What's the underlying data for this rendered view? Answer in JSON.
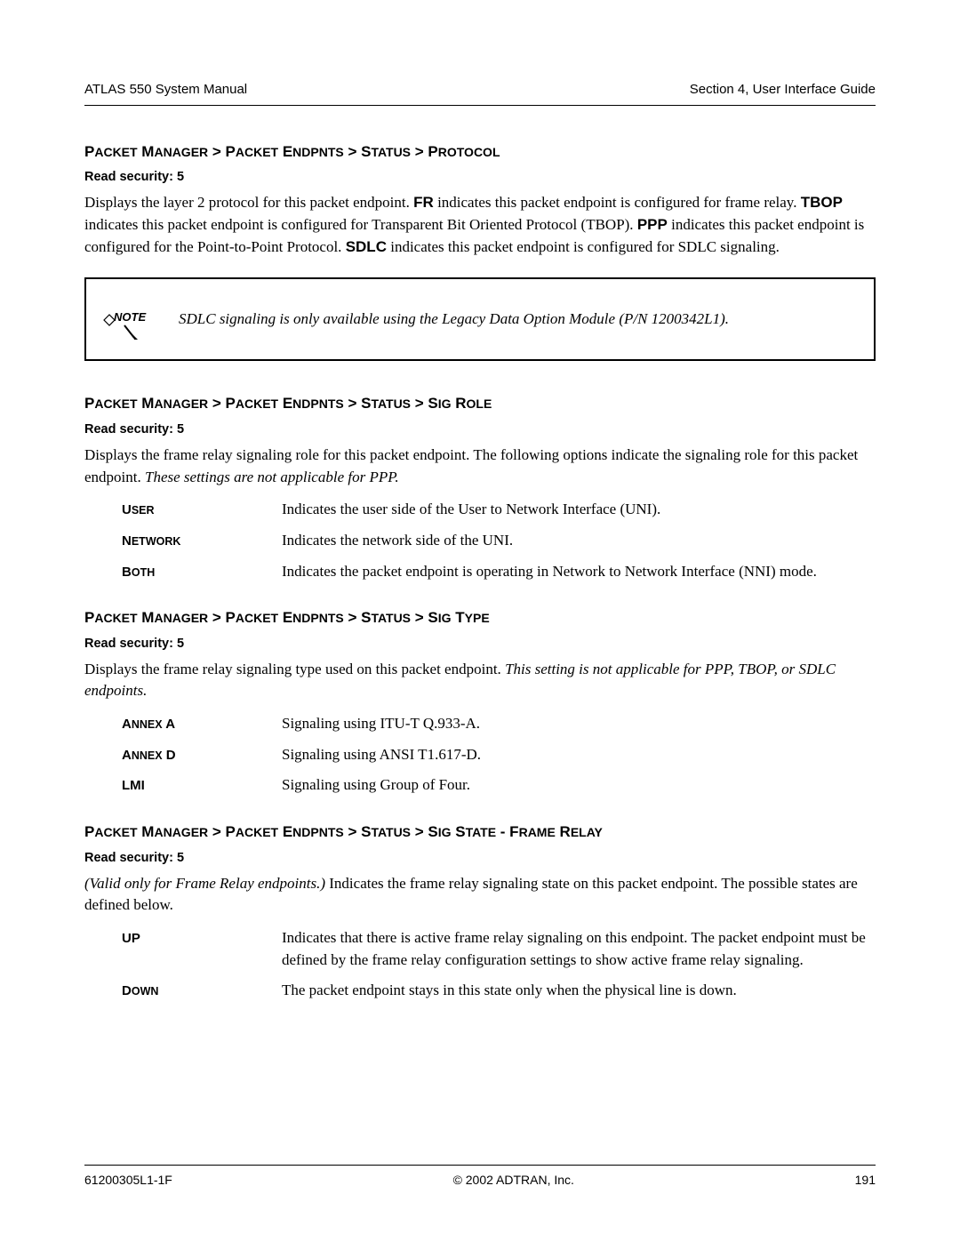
{
  "header": {
    "left": "ATLAS 550 System Manual",
    "right": "Section 4, User Interface Guide"
  },
  "section1": {
    "heading_parts": [
      "P",
      "ACKET",
      " M",
      "ANAGER",
      " > P",
      "ACKET",
      " E",
      "NDPNTS",
      " > S",
      "TATUS",
      " > P",
      "ROTOCOL"
    ],
    "read_sec": "Read security: 5",
    "para_pre_FR": "Displays the layer 2 protocol for this packet endpoint. ",
    "b_FR": "FR",
    "para_post_FR": " indicates this packet endpoint is configured for frame relay. ",
    "b_TBOP": "TBOP",
    "para_post_TBOP": " indicates this packet endpoint is configured for Transparent Bit Oriented Protocol (TBOP). ",
    "b_PPP": "PPP",
    "para_post_PPP": " indicates this packet endpoint is configured for the Point-to-Point Protocol. ",
    "b_SDLC": "SDLC",
    "para_post_SDLC": " indicates this packet endpoint is configured for SDLC signaling.",
    "note_label": "NOTE",
    "note_text": "SDLC signaling is only available using the Legacy Data Option Module (P/N 1200342L1)."
  },
  "section2": {
    "heading_parts": [
      "P",
      "ACKET",
      " M",
      "ANAGER",
      " > P",
      "ACKET",
      " E",
      "NDPNTS",
      " > S",
      "TATUS",
      " > S",
      "IG",
      " R",
      "OLE"
    ],
    "read_sec": "Read security: 5",
    "para_a": "Displays the frame relay signaling role for this packet endpoint. The following options indicate the signaling role for this packet endpoint. ",
    "para_italic": "These settings are not applicable for PPP.",
    "defs": [
      {
        "term_parts": [
          "U",
          "SER"
        ],
        "desc": "Indicates the user side of the User to Network Interface (UNI)."
      },
      {
        "term_parts": [
          "N",
          "ETWORK"
        ],
        "desc": "Indicates the network side of the UNI."
      },
      {
        "term_parts": [
          "B",
          "OTH"
        ],
        "desc": "Indicates the packet endpoint is operating in Network to Network Interface (NNI) mode."
      }
    ]
  },
  "section3": {
    "heading_parts": [
      "P",
      "ACKET",
      " M",
      "ANAGER",
      " > P",
      "ACKET",
      " E",
      "NDPNTS",
      " > S",
      "TATUS",
      " > S",
      "IG",
      " T",
      "YPE"
    ],
    "read_sec": "Read security: 5",
    "para_a": "Displays the frame relay signaling type used on this packet endpoint. ",
    "para_italic": "This setting is not applicable for PPP, TBOP, or SDLC endpoints.",
    "defs": [
      {
        "term_parts": [
          "A",
          "NNEX",
          " A"
        ],
        "desc": "Signaling using ITU-T Q.933-A."
      },
      {
        "term_parts": [
          "A",
          "NNEX",
          " D"
        ],
        "desc": "Signaling using ANSI T1.617-D."
      },
      {
        "term_parts": [
          "LMI"
        ],
        "desc": "Signaling using Group of Four."
      }
    ]
  },
  "section4": {
    "heading_parts": [
      "P",
      "ACKET",
      " M",
      "ANAGER",
      " > P",
      "ACKET",
      " E",
      "NDPNTS",
      " > S",
      "TATUS",
      " > S",
      "IG",
      " S",
      "TATE",
      " - F",
      "RAME",
      " R",
      "ELAY"
    ],
    "read_sec": "Read security: 5",
    "para_italic": "(Valid only for Frame Relay endpoints.)",
    "para_a": " Indicates the frame relay signaling state on this packet endpoint. The possible states are defined below.",
    "defs": [
      {
        "term_parts": [
          "UP"
        ],
        "desc": "Indicates that there is active frame relay signaling on this endpoint. The packet endpoint must be defined by the frame relay configuration settings to show active frame relay signaling."
      },
      {
        "term_parts": [
          "D",
          "OWN"
        ],
        "desc": "The packet endpoint stays in this state only when the physical line is down."
      }
    ]
  },
  "footer": {
    "left": "61200305L1-1F",
    "center": "© 2002 ADTRAN, Inc.",
    "right": "191"
  }
}
